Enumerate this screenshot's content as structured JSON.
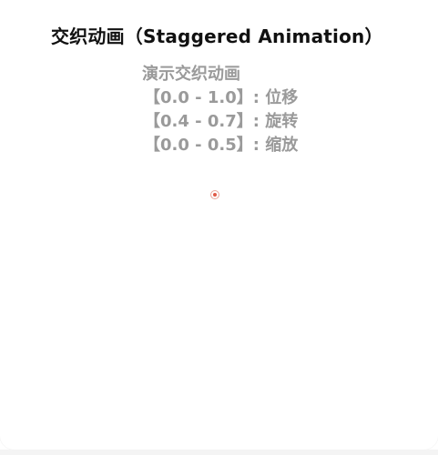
{
  "header": {
    "title": "交织动画（Staggered Animation）"
  },
  "description": {
    "lines": [
      "演示交织动画",
      "【0.0 - 1.0】: 位移",
      "【0.4 - 0.7】: 旋转",
      "【0.0 - 0.5】: 缩放"
    ]
  },
  "animation": {
    "dot_icon": "animated-dot-icon",
    "dot_color": "#e05a47",
    "ring_color": "#e8a59b"
  }
}
